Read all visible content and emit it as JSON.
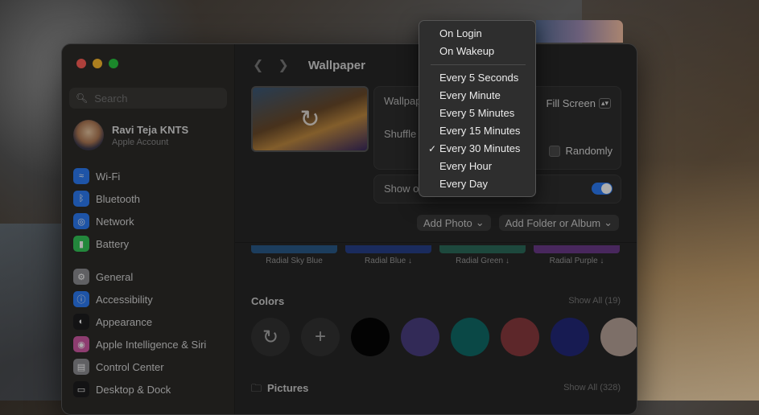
{
  "window": {
    "title": "Wallpaper"
  },
  "search": {
    "placeholder": "Search"
  },
  "profile": {
    "name": "Ravi Teja KNTS",
    "subtitle": "Apple Account"
  },
  "sidebar": {
    "group1": [
      {
        "label": "Wi-Fi",
        "icon": "wifi-icon",
        "color": "#2d7df6"
      },
      {
        "label": "Bluetooth",
        "icon": "bluetooth-icon",
        "color": "#2d7df6"
      },
      {
        "label": "Network",
        "icon": "globe-icon",
        "color": "#2d7df6"
      },
      {
        "label": "Battery",
        "icon": "battery-icon",
        "color": "#34c759"
      }
    ],
    "group2": [
      {
        "label": "General",
        "icon": "gear-icon",
        "color": "#8e8e93"
      },
      {
        "label": "Accessibility",
        "icon": "accessibility-icon",
        "color": "#2d7df6"
      },
      {
        "label": "Appearance",
        "icon": "appearance-icon",
        "color": "#1c1c1e"
      },
      {
        "label": "Apple Intelligence & Siri",
        "icon": "siri-icon",
        "color": "#d15ba6"
      },
      {
        "label": "Control Center",
        "icon": "control-center-icon",
        "color": "#8e8e93"
      },
      {
        "label": "Desktop & Dock",
        "icon": "dock-icon",
        "color": "#1c1c1e"
      }
    ]
  },
  "settings": {
    "wallpaper_label": "Wallpaper",
    "fill_value": "Fill Screen",
    "shuffle_label": "Shuffle",
    "randomly_label": "Randomly",
    "show_label": "Show on all Spaces",
    "add_photo": "Add Photo",
    "add_folder": "Add Folder or Album"
  },
  "thumbnails": [
    {
      "label": "Radial Sky Blue",
      "color": "#2a5b8a"
    },
    {
      "label": "Radial Blue ↓",
      "color": "#27408a"
    },
    {
      "label": "Radial Green ↓",
      "color": "#2b6a5a"
    },
    {
      "label": "Radial Purple ↓",
      "color": "#6a3a8a"
    }
  ],
  "colors_section": {
    "title": "Colors",
    "show_all": "Show All (19)"
  },
  "color_swatches": [
    "#050505",
    "#4a3f80",
    "#0f6b68",
    "#8a3a3e",
    "#23287a",
    "#b9a49a"
  ],
  "pictures_section": {
    "title": "Pictures",
    "show_all": "Show All (328)"
  },
  "menu": {
    "top": [
      {
        "label": "On Login",
        "checked": false
      },
      {
        "label": "On Wakeup",
        "checked": false
      }
    ],
    "bottom": [
      {
        "label": "Every 5 Seconds",
        "checked": false
      },
      {
        "label": "Every Minute",
        "checked": false
      },
      {
        "label": "Every 5 Minutes",
        "checked": false
      },
      {
        "label": "Every 15 Minutes",
        "checked": false
      },
      {
        "label": "Every 30 Minutes",
        "checked": true
      },
      {
        "label": "Every Hour",
        "checked": false
      },
      {
        "label": "Every Day",
        "checked": false
      }
    ]
  }
}
